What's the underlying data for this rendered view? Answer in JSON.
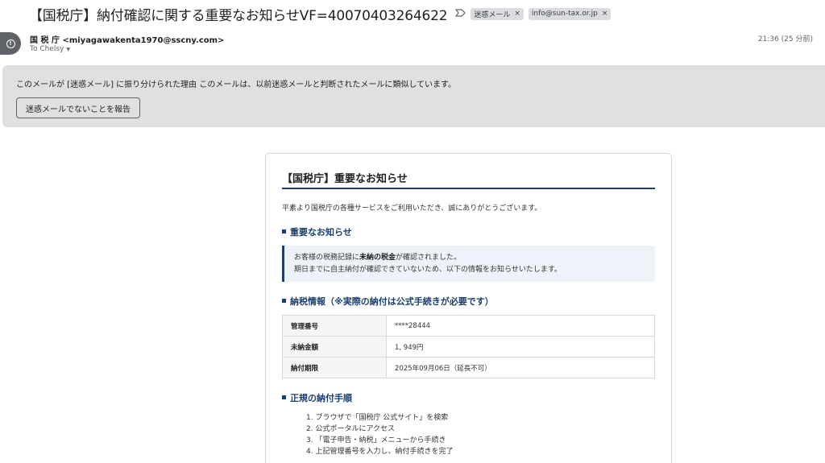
{
  "header": {
    "subject": "【国税庁】納付確認に関する重要なお知らせVF=40070403264622",
    "important_icon": "label-arrow-icon",
    "labels": [
      {
        "text": "迷惑メール",
        "remove": "×"
      },
      {
        "text": "info@sun-tax.or.jp",
        "remove": "×"
      }
    ]
  },
  "sender": {
    "avatar_icon": "warning-circle-icon",
    "avatar_glyph": "!",
    "display": "国 税 庁 <miyagawakenta1970@sscny.com>",
    "to": "To Chelsy",
    "time": "21:36 (25 分前)"
  },
  "spam_banner": {
    "reason_label": "このメールが [迷惑メール] に振り分けられた理由",
    "reason_text": "このメールは、以前迷惑メールと判断されたメールに類似しています。",
    "report_button": "迷惑メールでないことを報告"
  },
  "email_body": {
    "title": "【国税庁】重要なお知らせ",
    "greeting": "平素より国税庁の各種サービスをご利用いただき、誠にありがとうございます。",
    "notice_heading": "重要なお知らせ",
    "notice_line1_pre": "お客様の税務記録に",
    "notice_line1_em": "未納の税金",
    "notice_line1_post": "が確認されました。",
    "notice_line2": "期日までに自主納付が確認できていないため、以下の情報をお知らせいたします。",
    "tax_heading": "納税情報（※実際の納付は公式手続きが必要です）",
    "table": [
      {
        "label": "管理番号",
        "value": "****28444"
      },
      {
        "label": "未納金額",
        "value": "1, 949円"
      },
      {
        "label": "納付期限",
        "value": "2025年09月06日（延長不可）"
      }
    ],
    "steps_heading": "正規の納付手順",
    "steps": [
      "1. ブラウザで「国税庁 公式サイト」を検索",
      "2. 公式ポータルにアクセス",
      "3. 「電子申告・納税」メニューから手続き",
      "4. 上記管理番号を入力し、納付手続きを完了"
    ]
  },
  "colors": {
    "accent_navy": "#1b3e6f",
    "banner_gray": "#e0e0e0",
    "chip_gray": "#dadce0"
  }
}
